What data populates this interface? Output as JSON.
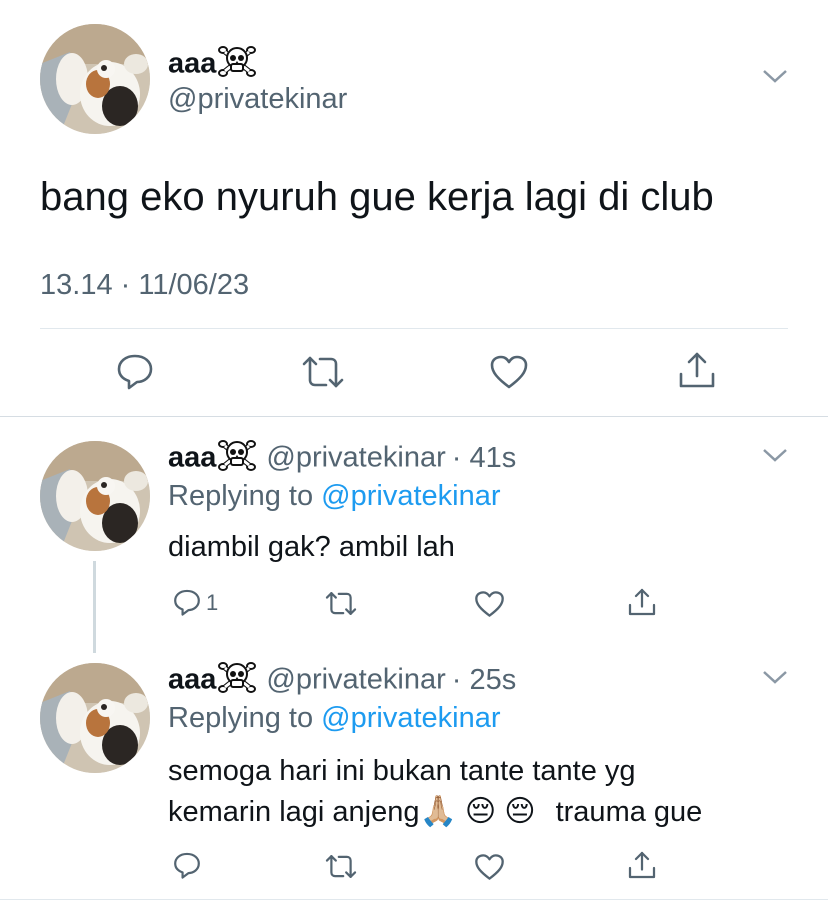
{
  "main_tweet": {
    "display_name": "aaa",
    "handle": "@privatekinar",
    "text": "bang eko nyuruh gue kerja lagi di club",
    "timestamp": "13.14 · 11/06/23"
  },
  "replies": [
    {
      "display_name": "aaa",
      "handle": "@privatekinar",
      "time": "· 41s",
      "replying_prefix": "Replying to",
      "replying_handle": "@privatekinar",
      "text_lines": [
        "diambil gak? ambil lah"
      ],
      "reply_count": "1"
    },
    {
      "display_name": "aaa",
      "handle": "@privatekinar",
      "time": "· 25s",
      "replying_prefix": "Replying to",
      "replying_handle": "@privatekinar",
      "text_lines": [
        "semoga hari ini bukan tante tante yg",
        "kemarin lagi anjeng",
        "trauma gue"
      ],
      "emojis": [
        "🙏🏼",
        "😔",
        "😔"
      ]
    }
  ],
  "icons": {
    "name_emoji": "skull-crossbones-icon",
    "reply": "reply-icon",
    "retweet": "retweet-icon",
    "like": "like-icon",
    "share": "share-icon",
    "menu": "chevron-down-icon"
  },
  "colors": {
    "text": "#0f1419",
    "secondary": "#536471",
    "link": "#1d9bf0",
    "divider": "#e1e8ed"
  }
}
